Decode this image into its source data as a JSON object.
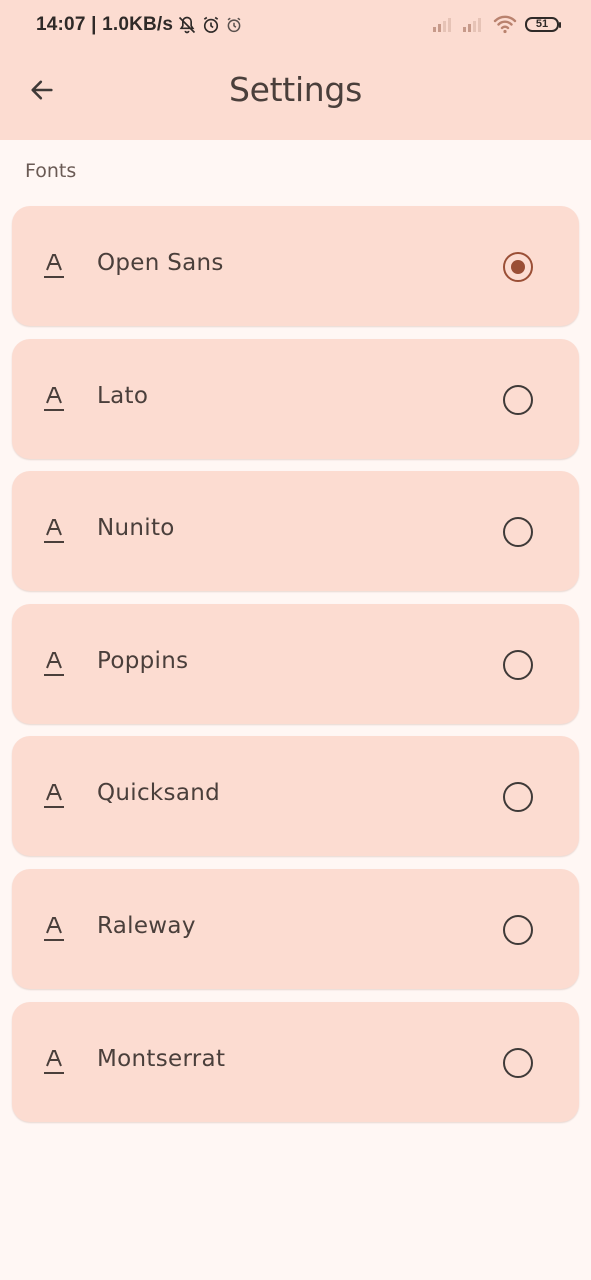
{
  "status_bar": {
    "time_and_speed": "14:07 | 1.0KB/s",
    "battery_level": "51"
  },
  "app_bar": {
    "title": "Settings"
  },
  "section": {
    "label": "Fonts"
  },
  "fonts": [
    {
      "label": "Open Sans",
      "selected": true
    },
    {
      "label": "Lato",
      "selected": false
    },
    {
      "label": "Nunito",
      "selected": false
    },
    {
      "label": "Poppins",
      "selected": false
    },
    {
      "label": "Quicksand",
      "selected": false
    },
    {
      "label": "Raleway",
      "selected": false
    },
    {
      "label": "Montserrat",
      "selected": false
    }
  ],
  "colors": {
    "app_bar_background": "#fcdcd1",
    "page_background": "#fff7f4",
    "card_background": "#fcdcd1",
    "accent": "#9a4f36",
    "text": "#4a3f3b"
  },
  "icons": {
    "back": "arrow-left-icon",
    "font": "font-a-underline-icon",
    "radio_selected": "radio-checked-icon",
    "radio_unselected": "radio-unchecked-icon"
  }
}
